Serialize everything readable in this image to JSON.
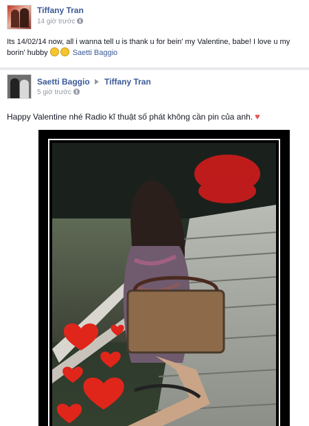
{
  "post1": {
    "author": "Tiffany Tran",
    "time": "14 giờ trước",
    "text": "Its 14/02/14 now, all i wanna tell u is thank u for bein' my Valentine, babe! I love u my borin' hubby",
    "tag": "Saetti Baggio",
    "avatar_icon": "profile-photo-icon"
  },
  "post2": {
    "author": "Saetti Baggio",
    "target": "Tiffany Tran",
    "time": "5 giờ trước",
    "text": "Happy Valentine nhé Radio kĩ thuật số phát không cần pin của anh.",
    "heart_icon": "heart-icon",
    "avatar_icon": "profile-photo-icon"
  },
  "photo": {
    "icon": "valentine-photo",
    "accent_heart": "#e0251b"
  },
  "colors": {
    "link": "#3b5998",
    "meta": "#9197a3",
    "text": "#141823"
  }
}
